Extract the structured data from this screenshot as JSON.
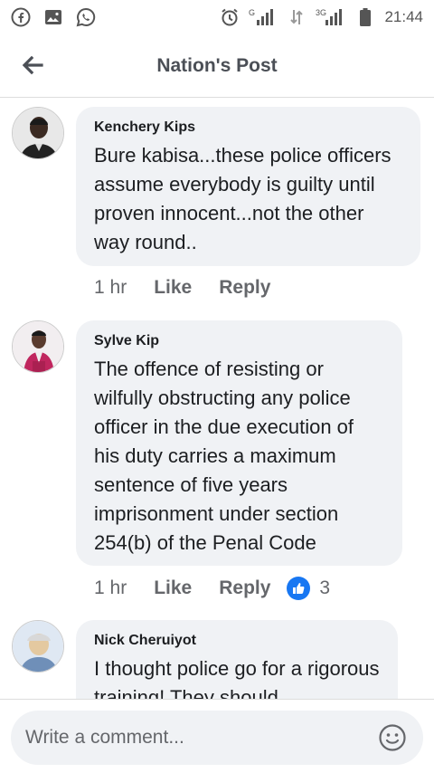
{
  "status_bar": {
    "time": "21:44",
    "left_icons": [
      "facebook-icon",
      "gallery-icon",
      "whatsapp-icon"
    ],
    "right_icons": [
      "alarm-icon",
      "signal-icon",
      "data-arrows-icon",
      "signal-3g-icon",
      "battery-icon"
    ],
    "net1": "G",
    "net2": "3G"
  },
  "header": {
    "title": "Nation's Post",
    "back_icon": "arrow-left-icon"
  },
  "comments": [
    {
      "author": "Kenchery Kips",
      "text": "Bure kabisa...these police officers assume everybody is guilty until proven innocent...not the other way round..",
      "time": "1 hr",
      "like_label": "Like",
      "reply_label": "Reply"
    },
    {
      "author": "Sylve Kip",
      "text": "The offence of resisting or wilfully obstructing any police officer in the due execution of his duty carries a maximum sentence of five years imprisonment under section 254(b) of the Penal Code",
      "time": "1 hr",
      "like_label": "Like",
      "reply_label": "Reply",
      "reaction_count": "3"
    },
    {
      "author": "Nick Cheruiyot",
      "text": "I thought police go for a rigorous training! They should"
    }
  ],
  "composer": {
    "placeholder": "Write a comment..."
  },
  "colors": {
    "accent": "#1877f2",
    "bubble": "#f0f2f5",
    "muted": "#65676b"
  }
}
